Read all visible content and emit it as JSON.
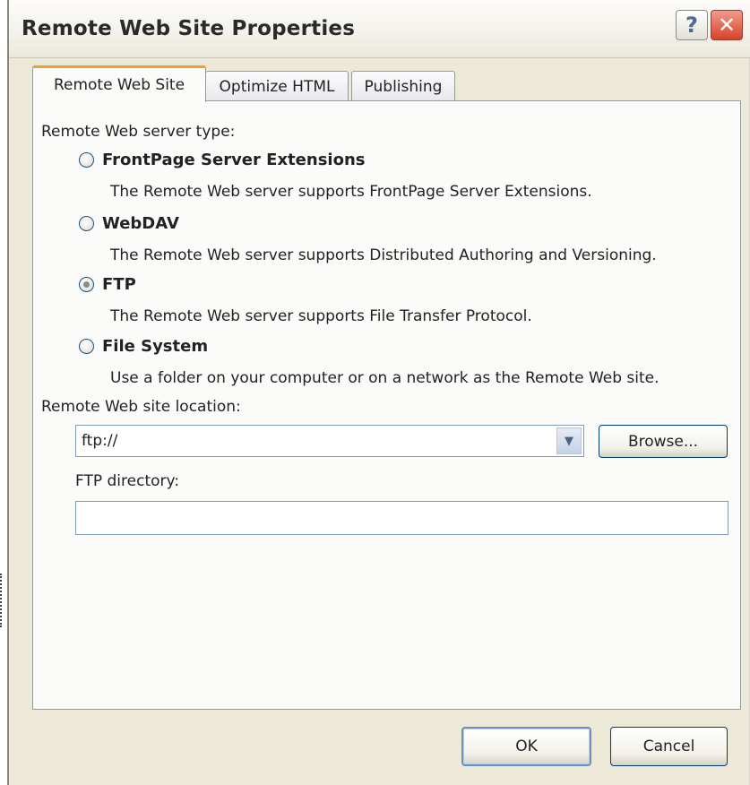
{
  "window": {
    "title": "Remote Web Site Properties",
    "help_glyph": "?",
    "close_glyph": "✕"
  },
  "tabs": [
    {
      "label": "Remote Web Site",
      "active": true
    },
    {
      "label": "Optimize HTML",
      "active": false
    },
    {
      "label": "Publishing",
      "active": false
    }
  ],
  "server_type": {
    "label": "Remote Web server type:",
    "selected": "FTP",
    "options": [
      {
        "label": "FrontPage Server Extensions",
        "description": "The Remote Web server supports FrontPage Server Extensions."
      },
      {
        "label": "WebDAV",
        "description": "The Remote Web server supports Distributed Authoring and Versioning."
      },
      {
        "label": "FTP",
        "description": "The Remote Web server supports File Transfer Protocol."
      },
      {
        "label": "File System",
        "description": "Use a folder on your computer or on a network as the Remote Web site."
      }
    ]
  },
  "location": {
    "label": "Remote Web site location:",
    "value": "ftp://",
    "browse_label": "Browse...",
    "dropdown_glyph": "▼"
  },
  "ftp_directory": {
    "label": "FTP directory:",
    "value": ""
  },
  "footer": {
    "ok_label": "OK",
    "cancel_label": "Cancel"
  },
  "colors": {
    "dialog_background": "#ece9d8",
    "active_tab_accent": "#f0a030",
    "close_button": "#d5432a",
    "input_border": "#7f9db9"
  }
}
